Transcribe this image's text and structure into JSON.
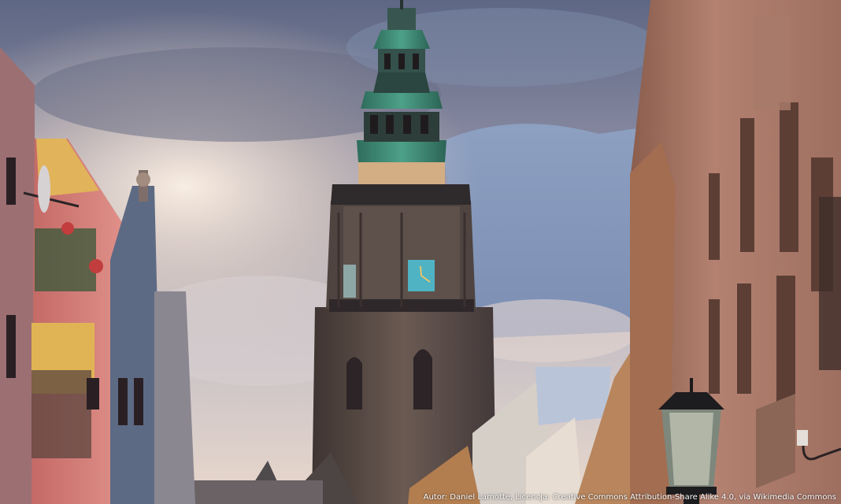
{
  "photo": {
    "subject": "",
    "credit": "Autor: Daniel Lamotte, Licencja: Creative Commons Attribution-Share Alike 4.0, via Wikimedia Commons"
  },
  "colors": {
    "sky_top": "#6f7590",
    "sky_glow": "#f4e6d8",
    "sky_blue": "#6f88b4",
    "tower_stone": "#5b4d48",
    "copper_roof": "#3f8f76",
    "clock_face": "#4fb3c4",
    "left_pink": "#d97d77",
    "left_yellow": "#e2b354",
    "right_facade": "#b07a66",
    "window_dark": "#3b2e2c"
  }
}
